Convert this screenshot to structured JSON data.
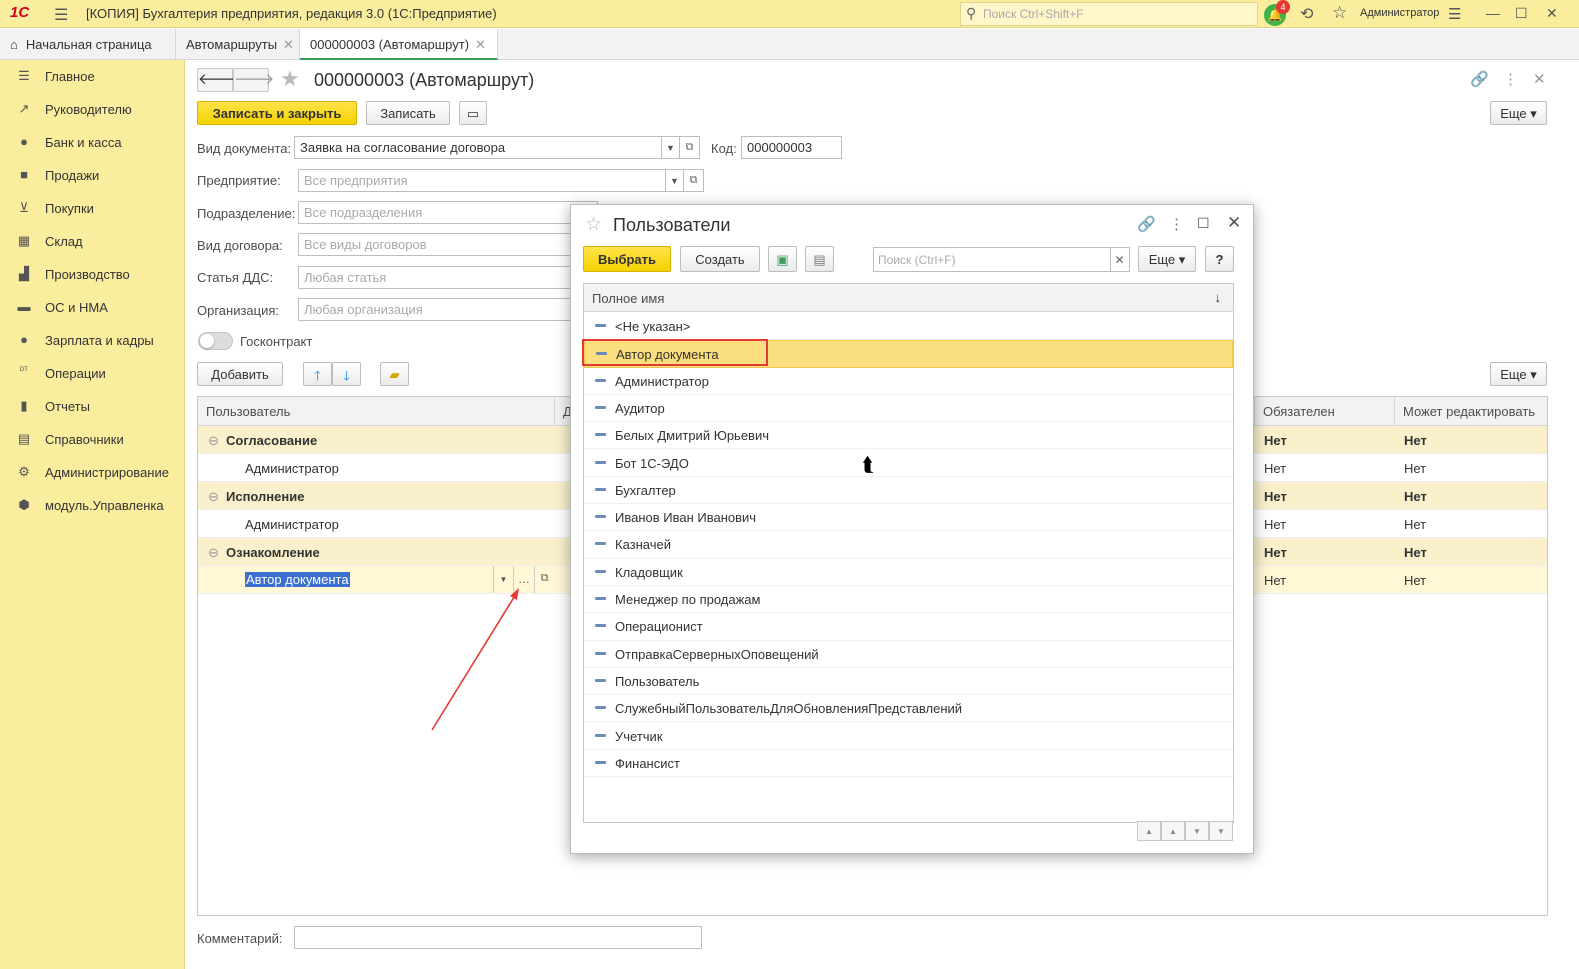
{
  "app": {
    "logo": "1С",
    "title": "[КОПИЯ] Бухгалтерия предприятия, редакция 3.0  (1С:Предприятие)",
    "search_placeholder": "Поиск Ctrl+Shift+F",
    "notifications_count": "4",
    "user": "Администратор"
  },
  "tabs": [
    {
      "label": "Начальная страница"
    },
    {
      "label": "Автомаршруты"
    },
    {
      "label": "000000003 (Автомаршрут)"
    }
  ],
  "sidebar": {
    "items": [
      {
        "label": "Главное",
        "icon": "menu-icon"
      },
      {
        "label": "Руководителю",
        "icon": "trend-icon"
      },
      {
        "label": "Банк и касса",
        "icon": "coin-icon"
      },
      {
        "label": "Продажи",
        "icon": "bag-icon"
      },
      {
        "label": "Покупки",
        "icon": "cart-icon"
      },
      {
        "label": "Склад",
        "icon": "warehouse-icon"
      },
      {
        "label": "Производство",
        "icon": "factory-icon"
      },
      {
        "label": "ОС и НМА",
        "icon": "truck-icon"
      },
      {
        "label": "Зарплата и кадры",
        "icon": "person-icon"
      },
      {
        "label": "Операции",
        "icon": "dt-kt-icon"
      },
      {
        "label": "Отчеты",
        "icon": "bar-chart-icon"
      },
      {
        "label": "Справочники",
        "icon": "book-icon"
      },
      {
        "label": "Администрирование",
        "icon": "gear-icon"
      },
      {
        "label": "модуль.Управленка",
        "icon": "cube-icon"
      }
    ]
  },
  "form": {
    "title": "000000003 (Автомаршрут)",
    "save_close": "Записать и закрыть",
    "save": "Записать",
    "more": "Еще",
    "add": "Добавить",
    "doc_type_label": "Вид документа:",
    "doc_type_value": "Заявка на согласование договора",
    "code_label": "Код:",
    "code_value": "000000003",
    "enterprise_label": "Предприятие:",
    "enterprise_ph": "Все предприятия",
    "division_label": "Подразделение:",
    "division_ph": "Все подразделения",
    "contract_type_label": "Вид договора:",
    "contract_type_ph": "Все виды договоров",
    "dds_label": "Статья ДДС:",
    "dds_ph": "Любая статья",
    "org_label": "Организация:",
    "org_ph": "Любая организация",
    "goscontract_label": "Госконтракт",
    "comment_label": "Комментарий:"
  },
  "grid": {
    "columns": [
      "Пользователь",
      "Д",
      "Обязателен",
      "Может редактировать"
    ],
    "rows": [
      {
        "user": "Согласование",
        "required": "Нет",
        "editable": "Нет",
        "group": true
      },
      {
        "user": "Администратор",
        "required": "Нет",
        "editable": "Нет",
        "group": false
      },
      {
        "user": "Исполнение",
        "required": "Нет",
        "editable": "Нет",
        "group": true
      },
      {
        "user": "Администратор",
        "required": "Нет",
        "editable": "Нет",
        "group": false
      },
      {
        "user": "Ознакомление",
        "required": "Нет",
        "editable": "Нет",
        "group": true
      },
      {
        "user": "Автор документа",
        "required": "Нет",
        "editable": "Нет",
        "group": false,
        "editing": true
      }
    ]
  },
  "dialog": {
    "title": "Пользователи",
    "select": "Выбрать",
    "create": "Создать",
    "search_placeholder": "Поиск (Ctrl+F)",
    "more": "Еще",
    "help": "?",
    "column": "Полное имя",
    "items": [
      "<Не указан>",
      "Автор документа",
      "Администратор",
      "Аудитор",
      "Белых Дмитрий Юрьевич",
      "Бот 1С-ЭДО",
      "Бухгалтер",
      "Иванов Иван Иванович",
      "Казначей",
      "Кладовщик",
      "Менеджер по продажам",
      "Операционист",
      "ОтправкаСерверныхОповещений",
      "Пользователь",
      "СлужебныйПользовательДляОбновленияПредставлений",
      "Учетчик",
      "Финансист"
    ],
    "selected_index": 1
  },
  "colors": {
    "accent_yellow": "#fbed9e",
    "button_yellow": "#f5d300",
    "highlight": "#fbde7d",
    "annotation_red": "#e53935"
  }
}
